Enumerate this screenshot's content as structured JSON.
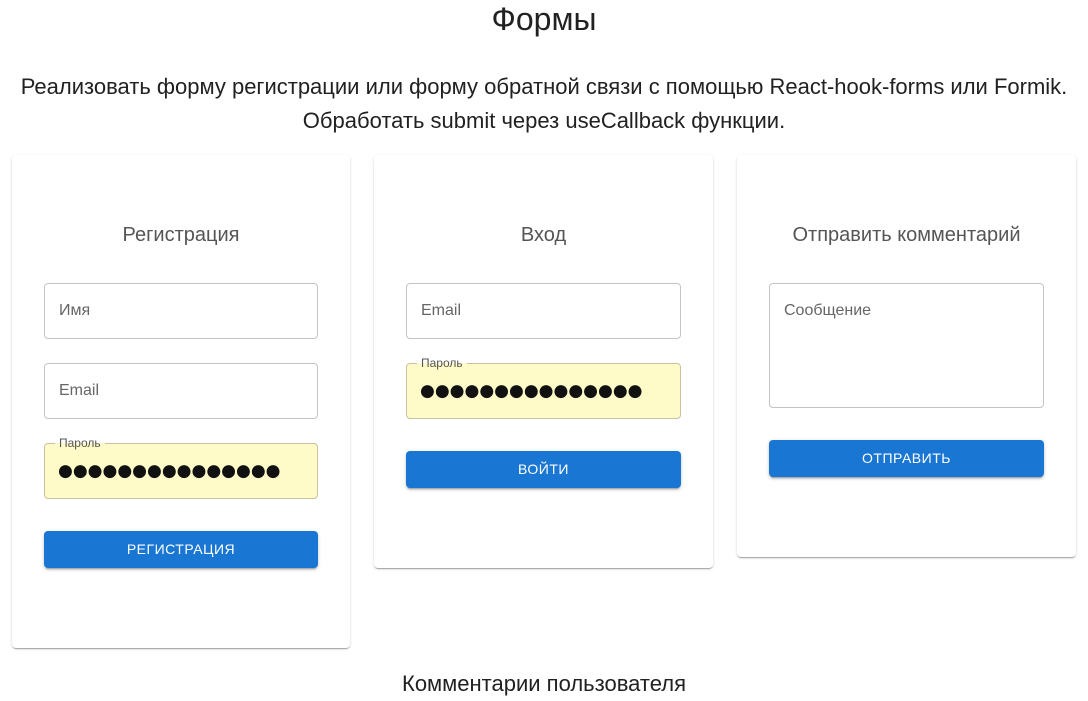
{
  "page": {
    "title": "Формы",
    "description": "Реализовать форму регистрации или форму обратной связи с помощью React-hook-forms или Formik. Обработать submit через useCallback функции.",
    "comments_title": "Комментарии пользователя"
  },
  "registration": {
    "title": "Регистрация",
    "name_placeholder": "Имя",
    "email_placeholder": "Email",
    "password_label": "Пароль",
    "password_value": "●●●●●●●●●●●●●●●",
    "button_label": "РЕГИСТРАЦИЯ"
  },
  "login": {
    "title": "Вход",
    "email_placeholder": "Email",
    "password_label": "Пароль",
    "password_value": "●●●●●●●●●●●●●●●",
    "button_label": "ВОЙТИ"
  },
  "comment": {
    "title": "Отправить комментарий",
    "message_placeholder": "Сообщение",
    "button_label": "ОТПРАВИТЬ"
  },
  "colors": {
    "primary": "#1976d2",
    "autofill_background": "#fefbc9"
  }
}
